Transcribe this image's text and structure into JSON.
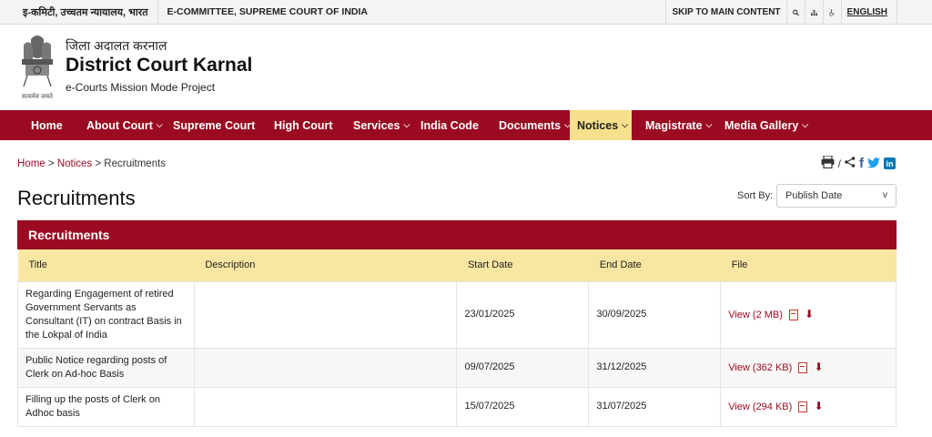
{
  "topbar": {
    "hindi_label": "इ-कमिटी, उच्चतम न्यायालय, भारत",
    "ecommittee_label": "E-COMMITTEE, SUPREME COURT OF INDIA",
    "skip_label": "SKIP TO MAIN CONTENT",
    "language_label": "ENGLISH"
  },
  "header": {
    "hindi_name": "जिला अदालत करनाल",
    "title": "District Court Karnal",
    "subtitle": "e-Courts Mission Mode Project",
    "motto": "सत्यमेव जयते"
  },
  "nav": {
    "items": [
      {
        "label": "Home"
      },
      {
        "label": "About Court"
      },
      {
        "label": "Supreme Court"
      },
      {
        "label": "High Court"
      },
      {
        "label": "Services"
      },
      {
        "label": "India Code"
      },
      {
        "label": "Documents"
      },
      {
        "label": "Notices"
      },
      {
        "label": "Magistrate"
      },
      {
        "label": "Media Gallery"
      }
    ]
  },
  "breadcrumb": {
    "home": "Home",
    "notices": "Notices",
    "current": "Recruitments",
    "separator": ">"
  },
  "share": {
    "slash": "/"
  },
  "page": {
    "title": "Recruitments",
    "sort_label": "Sort By:",
    "sort_value": "Publish Date",
    "sort_arrow": "v"
  },
  "panel": {
    "title": "Recruitments",
    "columns": [
      "Title",
      "Description",
      "Start Date",
      "End Date",
      "File"
    ],
    "rows": [
      {
        "title": "Regarding Engagement of retired Government Servants as Consultant (IT) on contract Basis in the Lokpal of India",
        "description": "",
        "start": "23/01/2025",
        "end": "30/09/2025",
        "file": "View (2 MB)"
      },
      {
        "title": "Public Notice regarding posts of Clerk on Ad-hoc Basis",
        "description": "",
        "start": "09/07/2025",
        "end": "31/12/2025",
        "file": "View (362 KB)"
      },
      {
        "title": "Filling up the posts of Clerk on Adhoc basis",
        "description": "",
        "start": "15/07/2025",
        "end": "31/07/2025",
        "file": "View (294 KB)"
      }
    ]
  },
  "colors": {
    "brand": "#9a0b22",
    "active_nav": "#f6e08b",
    "table_head": "#f9e6a2"
  }
}
